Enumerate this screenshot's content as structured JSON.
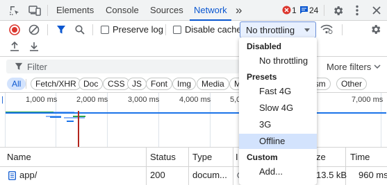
{
  "tabs": {
    "elements": "Elements",
    "console": "Console",
    "sources": "Sources",
    "network": "Network",
    "more": "»"
  },
  "badges": {
    "errors": "1",
    "messages": "24"
  },
  "toolbar": {
    "preserve_log": "Preserve log",
    "disable_cache": "Disable cache",
    "throttling_value": "No throttling"
  },
  "filter": {
    "placeholder": "Filter",
    "more_filters": "More filters"
  },
  "chips": [
    "All",
    "Fetch/XHR",
    "Doc",
    "CSS",
    "JS",
    "Font",
    "Img",
    "Media",
    "M",
    "asm",
    "Other"
  ],
  "timeline": {
    "ticks": [
      "1,000 ms",
      "2,000 ms",
      "3,000 ms",
      "4,000 ms",
      "5,0",
      "7,000 ms"
    ]
  },
  "table": {
    "headers": {
      "name": "Name",
      "status": "Status",
      "type": "Type",
      "initiator": "I",
      "size": "ze",
      "time": "Time"
    },
    "rows": [
      {
        "name": "app/",
        "status": "200",
        "type": "docum...",
        "size": "13.5 kB",
        "time": "960 ms"
      }
    ]
  },
  "throttle_menu": {
    "disabled_heading": "Disabled",
    "disabled_items": [
      "No throttling"
    ],
    "presets_heading": "Presets",
    "presets_items": [
      "Fast 4G",
      "Slow 4G",
      "3G",
      "Offline"
    ],
    "custom_heading": "Custom",
    "custom_items": [
      "Add..."
    ],
    "highlighted": "Offline"
  },
  "colors": {
    "accent": "#0b57d0",
    "error": "#dc362e",
    "highlight": "#d3e3fd"
  }
}
